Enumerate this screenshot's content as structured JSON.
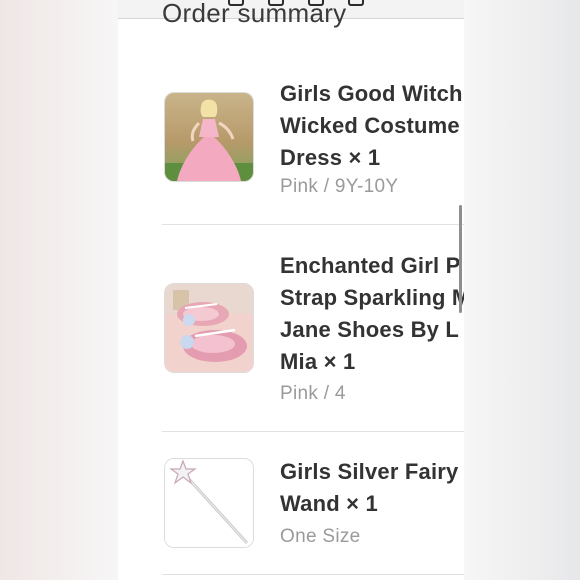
{
  "order": {
    "title": "Order summary",
    "items": [
      {
        "name": "Girls Good Witch\nWicked Costume\nDress × 1",
        "variant": "Pink / 9Y-10Y",
        "thumbnail_icon": "pink-dress-photo"
      },
      {
        "name": "Enchanted Girl P\nStrap Sparkling M\nJane Shoes By L\nMia × 1",
        "variant": "Pink / 4",
        "thumbnail_icon": "pink-shoes-photo"
      },
      {
        "name": "Girls Silver Fairy\nWand × 1",
        "variant": "One Size",
        "thumbnail_icon": "star-wand-photo"
      }
    ]
  },
  "colors": {
    "text": "#333333",
    "muted": "#9a9a9a",
    "divider": "#e2e2e4"
  }
}
